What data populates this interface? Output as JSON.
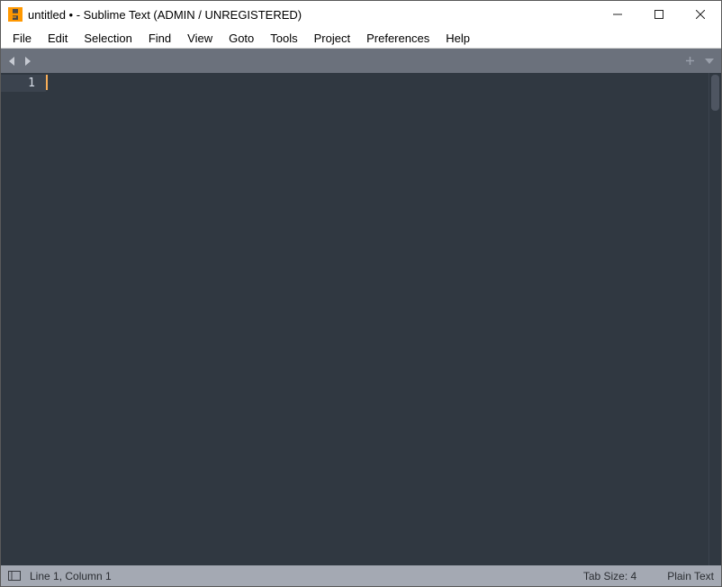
{
  "window": {
    "title": "untitled • - Sublime Text (ADMIN / UNREGISTERED)"
  },
  "menu": {
    "items": [
      "File",
      "Edit",
      "Selection",
      "Find",
      "View",
      "Goto",
      "Tools",
      "Project",
      "Preferences",
      "Help"
    ]
  },
  "editor": {
    "line_number": "1"
  },
  "status": {
    "position": "Line 1, Column 1",
    "tab_size": "Tab Size: 4",
    "syntax": "Plain Text"
  }
}
